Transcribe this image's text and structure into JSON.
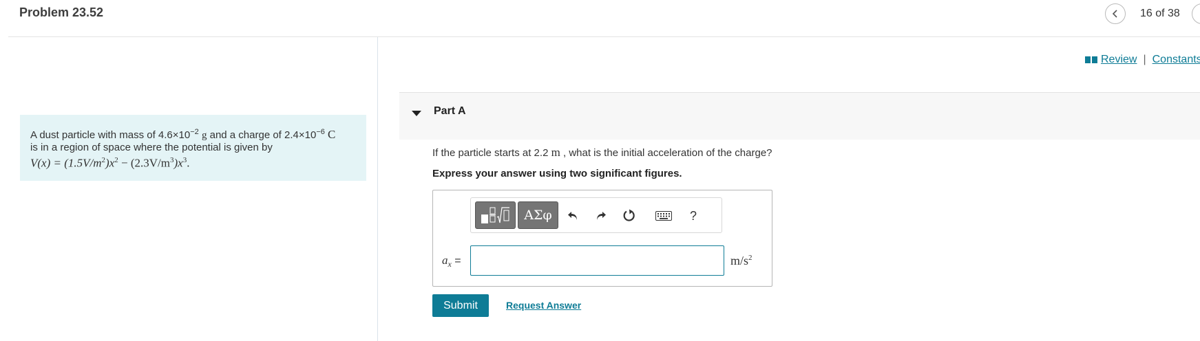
{
  "header": {
    "title": "Problem 23.52",
    "page_count": "16 of 38"
  },
  "problem": {
    "text_1": "A dust particle with mass of 4.6×10",
    "mass_exp": "−2",
    "mass_unit": "g",
    "text_2": " and a charge of 2.4×10",
    "charge_exp": "−6",
    "charge_unit": "C",
    "text_3": "is in a region of space where the potential is given by",
    "eq_lhs": "V(x) = (1.5V/m",
    "eq_exp1": "2",
    "eq_mid1": ")x",
    "eq_exp2": "2",
    "eq_mid2": " − (2.3V/m",
    "eq_exp3": "3",
    "eq_mid3": ")x",
    "eq_exp4": "3",
    "eq_end": "."
  },
  "links": {
    "review": "Review",
    "separator": "|",
    "constants": "Constants"
  },
  "part": {
    "title": "Part A",
    "question_pre": "If the particle starts at 2.2 ",
    "question_unit": "m",
    "question_post": " , what is the initial acceleration of the charge?",
    "instruction": "Express your answer using two significant figures."
  },
  "toolbar": {
    "symbols_label": "ΑΣφ",
    "help_label": "?",
    "icons": [
      "templates-icon",
      "undo-icon",
      "redo-icon",
      "reset-icon",
      "keyboard-icon",
      "help-icon"
    ]
  },
  "answer": {
    "variable": "a",
    "variable_sub": "x",
    "equals": " =",
    "value": "",
    "unit_base": "m/s",
    "unit_exp": "2"
  },
  "actions": {
    "submit_label": "Submit",
    "request_label": "Request Answer"
  },
  "colors": {
    "accent": "#0e7c96",
    "problem_bg": "#e4f4f6",
    "part_header_bg": "#f7f7f7"
  }
}
